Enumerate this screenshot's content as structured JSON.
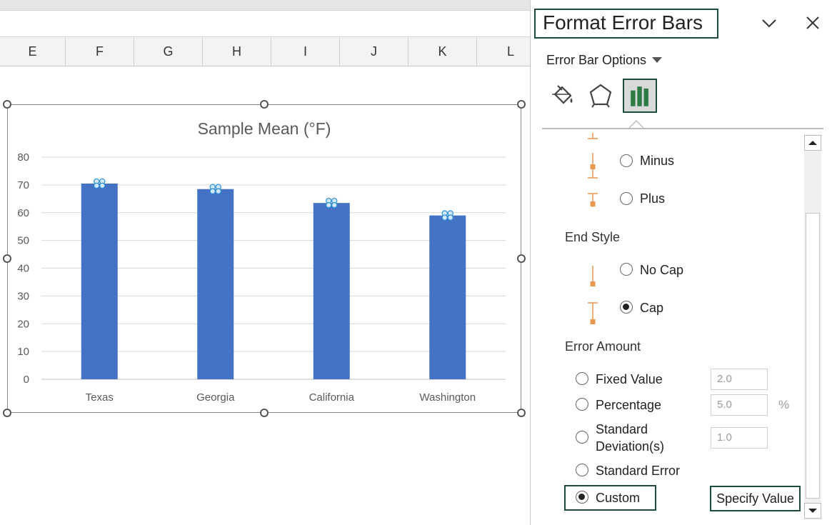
{
  "spreadsheet": {
    "columns": [
      "E",
      "F",
      "G",
      "H",
      "I",
      "J",
      "K",
      "L"
    ]
  },
  "chart_data": {
    "type": "bar",
    "title": "Sample Mean (°F)",
    "categories": [
      "Texas",
      "Georgia",
      "California",
      "Washington"
    ],
    "values": [
      70.5,
      68.5,
      63.5,
      59
    ],
    "ylim": [
      0,
      80
    ],
    "yticks": [
      0,
      10,
      20,
      30,
      40,
      50,
      60,
      70,
      80
    ],
    "grid": true,
    "bar_color": "#4472c4",
    "error_bars": "selected (custom)"
  },
  "pane": {
    "title": "Format Error Bars",
    "options_dropdown": "Error Bar Options",
    "tabs": [
      "fill-line-icon",
      "effects-icon",
      "error-bar-options-icon"
    ],
    "direction": {
      "minus": "Minus",
      "plus": "Plus"
    },
    "end_style": {
      "heading": "End Style",
      "no_cap": "No Cap",
      "cap": "Cap",
      "selected": "Cap"
    },
    "error_amount": {
      "heading": "Error Amount",
      "fixed_value": "Fixed Value",
      "fixed_value_input": "2.0",
      "percentage": "Percentage",
      "percentage_input": "5.0",
      "percent_sign": "%",
      "std_dev_line1": "Standard",
      "std_dev_line2": "Deviation(s)",
      "std_dev_input": "1.0",
      "standard_error": "Standard Error",
      "custom": "Custom",
      "selected": "Custom",
      "specify_value": "Specify Value"
    },
    "accent_color": "#1e4b3f",
    "glyph_color": "#e8974f"
  }
}
